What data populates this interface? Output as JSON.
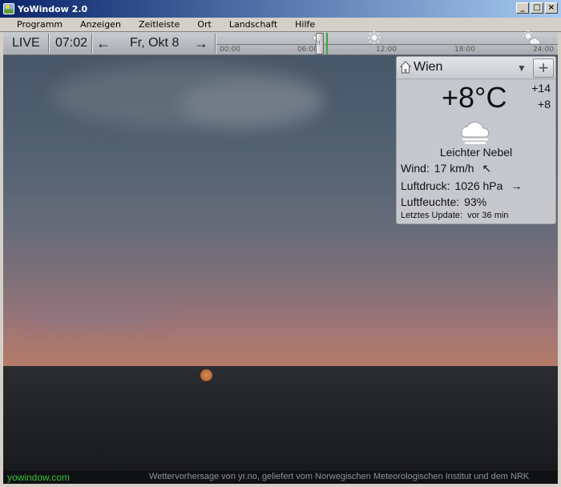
{
  "window": {
    "title": "YoWindow 2.0",
    "buttons": {
      "minimize": "_",
      "maximize": "□",
      "close": "×"
    }
  },
  "menu": [
    "Programm",
    "Anzeigen",
    "Zeitleiste",
    "Ort",
    "Landschaft",
    "Hilfe"
  ],
  "toolbar": {
    "live": "LIVE",
    "time": "07:02",
    "prev_arrow": "←",
    "date": "Fr, Okt 8",
    "next_arrow": "→"
  },
  "timeline": {
    "labels": [
      "00:00",
      "06:00",
      "12:00",
      "18:00",
      "24:00"
    ],
    "current_hour": 7.0
  },
  "weather": {
    "location": "Wien",
    "add_button": "+",
    "temperature": "+8°C",
    "high": "+14",
    "low": "+8",
    "condition": "Leichter Nebel",
    "wind_label": "Wind:",
    "wind_value": "17 km/h",
    "wind_arrow": "↖",
    "pressure_label": "Luftdruck:",
    "pressure_value": "1026 hPa",
    "pressure_arrow": "→",
    "humidity_label": "Luftfeuchte:",
    "humidity_value": "93%",
    "update_label": "Letztes Update:",
    "update_value": "vor 36 min"
  },
  "footer": {
    "site": "yowindow.com",
    "credit": "Wettervorhersage von yr.no, geliefert vom Norwegischen Meteorologischen Institut und dem NRK"
  },
  "colors": {
    "title_bar": "#0a246a",
    "now_marker": "#34a836",
    "site_link": "#36c23a"
  }
}
